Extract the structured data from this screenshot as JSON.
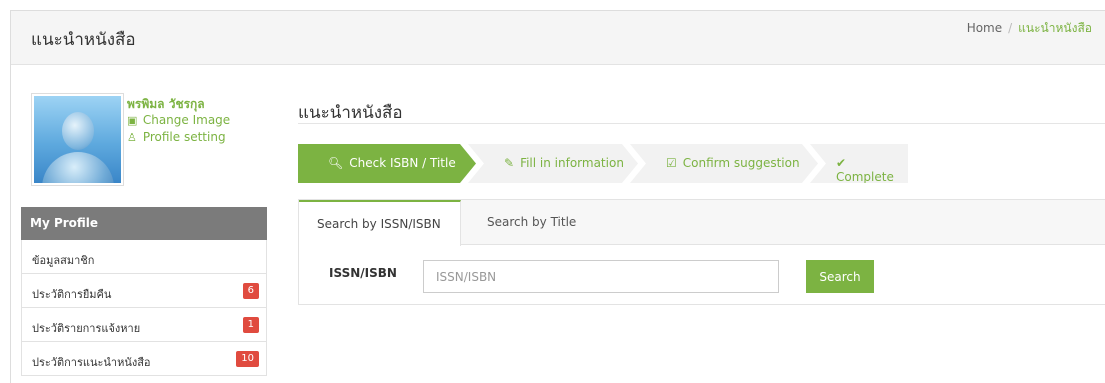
{
  "header": {
    "title": "แนะนำหนังสือ",
    "breadcrumb": {
      "home": "Home",
      "separator": "/",
      "current": "แนะนำหนังสือ"
    }
  },
  "profile": {
    "name": "พรพิมล วัชรกุล",
    "change_image": "Change Image",
    "profile_setting": "Profile setting"
  },
  "sidebar": {
    "heading": "My Profile",
    "items": [
      {
        "label": "ข้อมูลสมาชิก",
        "badge": ""
      },
      {
        "label": "ประวัติการยืมคืน",
        "badge": "6"
      },
      {
        "label": "ประวัติรายการแจ้งหาย",
        "badge": "1"
      },
      {
        "label": "ประวัติการแนะนำหนังสือ",
        "badge": "10"
      }
    ]
  },
  "main": {
    "title": "แนะนำหนังสือ",
    "steps": [
      {
        "label": "Check ISBN / Title",
        "icon": "search-icon"
      },
      {
        "label": "Fill in information",
        "icon": "pencil-icon"
      },
      {
        "label": "Confirm suggestion",
        "icon": "check-square-icon"
      },
      {
        "label": "Complete",
        "icon": "check-icon"
      }
    ],
    "tabs": [
      {
        "label": "Search by ISSN/ISBN"
      },
      {
        "label": "Search by Title"
      }
    ],
    "form": {
      "label": "ISSN/ISBN",
      "placeholder": "ISSN/ISBN",
      "value": "",
      "button": "Search"
    }
  },
  "colors": {
    "accent": "#7cb342",
    "badge": "#e04b3f",
    "sidebar_head": "#7b7b7b"
  }
}
